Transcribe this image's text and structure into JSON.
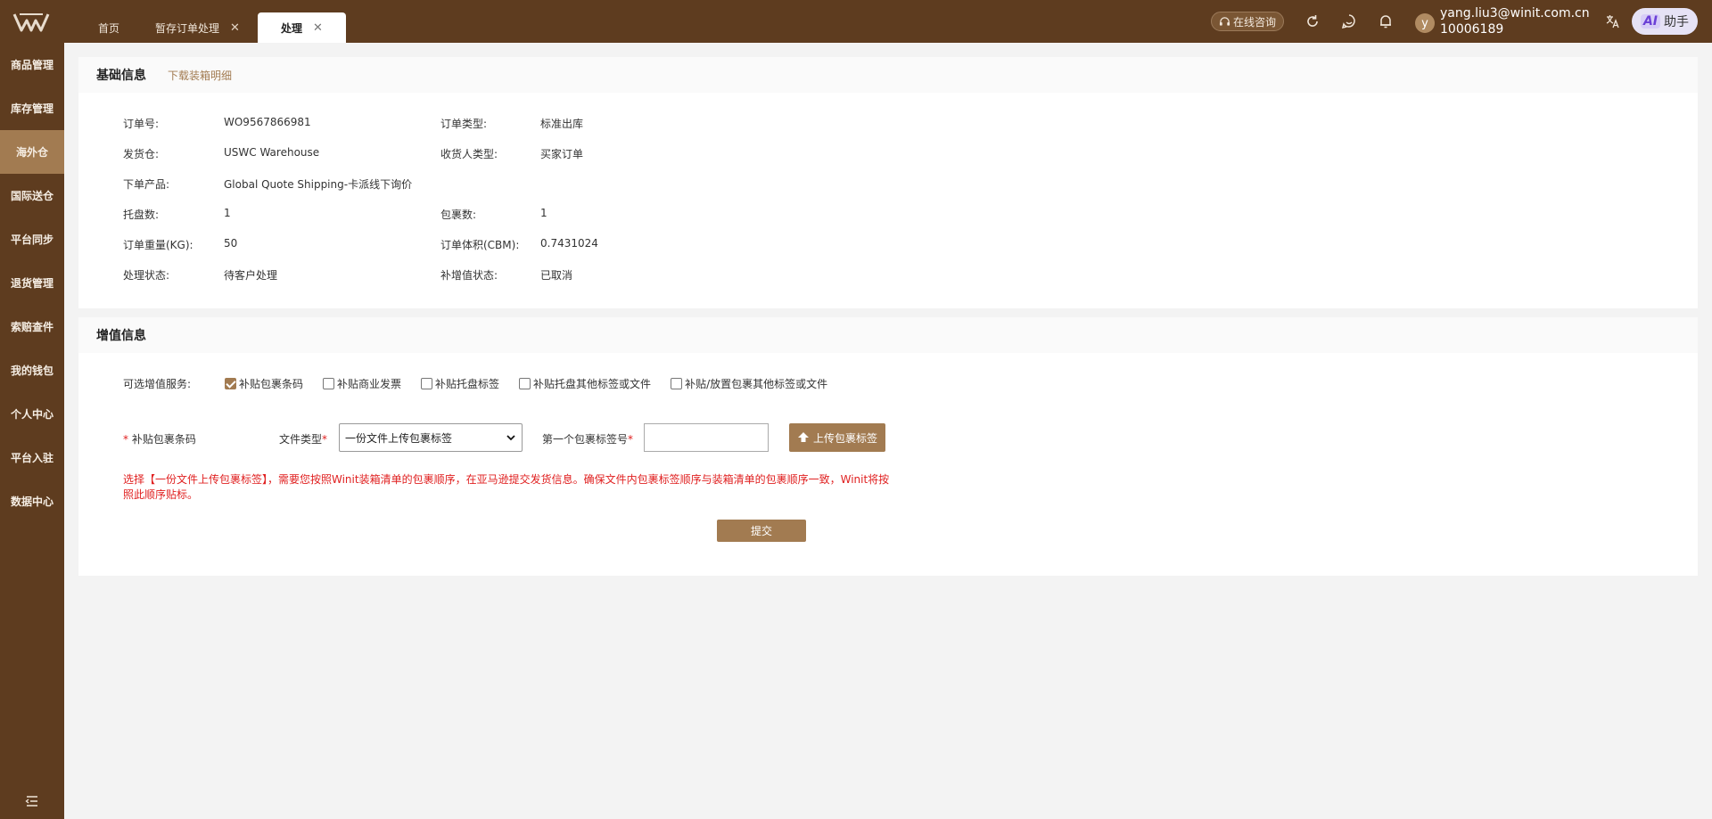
{
  "colors": {
    "brand": "#5e3c1f",
    "accent": "#a27b51",
    "warning": "#e02020"
  },
  "tabs": [
    {
      "label": "首页",
      "closable": false
    },
    {
      "label": "暂存订单处理",
      "closable": true
    },
    {
      "label": "处理",
      "closable": true,
      "active": true
    }
  ],
  "header": {
    "consult_label": "在线咨询",
    "user_email": "yang.liu3@winit.com.cn",
    "user_id": "10006189",
    "avatar_letter": "y",
    "ai_label": "AI",
    "assistant_label": "助手"
  },
  "sidebar": {
    "items": [
      {
        "label": "商品管理"
      },
      {
        "label": "库存管理"
      },
      {
        "label": "海外仓",
        "active": true
      },
      {
        "label": "国际送仓"
      },
      {
        "label": "平台同步"
      },
      {
        "label": "退货管理"
      },
      {
        "label": "索赔查件"
      },
      {
        "label": "我的钱包"
      },
      {
        "label": "个人中心"
      },
      {
        "label": "平台入驻"
      },
      {
        "label": "数据中心"
      }
    ]
  },
  "basic": {
    "title": "基础信息",
    "download_link": "下载装箱明细",
    "fields": [
      {
        "label": "订单号:",
        "value": "WO9567866981"
      },
      {
        "label": "订单类型:",
        "value": "标准出库"
      },
      {
        "label": "发货仓:",
        "value": "USWC Warehouse"
      },
      {
        "label": "收货人类型:",
        "value": "买家订单"
      },
      {
        "label": "下单产品:",
        "value": "Global Quote Shipping-卡派线下询价"
      },
      {
        "label": "托盘数:",
        "value": "1"
      },
      {
        "label": "包裹数:",
        "value": "1"
      },
      {
        "label": "订单重量(KG):",
        "value": "50"
      },
      {
        "label": "订单体积(CBM):",
        "value": "0.7431024"
      },
      {
        "label": "处理状态:",
        "value": "待客户处理"
      },
      {
        "label": "补增值状态:",
        "value": "已取消"
      }
    ]
  },
  "vas": {
    "title": "增值信息",
    "optional_label": "可选增值服务:",
    "options": [
      {
        "label": "补贴包裹条码",
        "checked": true
      },
      {
        "label": "补贴商业发票",
        "checked": false
      },
      {
        "label": "补贴托盘标签",
        "checked": false
      },
      {
        "label": "补贴托盘其他标签或文件",
        "checked": false
      },
      {
        "label": "补贴/放置包裹其他标签或文件",
        "checked": false
      }
    ],
    "barcode_label": "补贴包裹条码",
    "file_type_label": "文件类型",
    "file_type_value": "一份文件上传包裹标签",
    "first_label_label": "第一个包裹标签号",
    "first_label_value": "",
    "upload_label": "上传包裹标签",
    "tip": "选择【一份文件上传包裹标签】，需要您按照Winit装箱清单的包裹顺序，在亚马逊提交发货信息。确保文件内包裹标签顺序与装箱清单的包裹顺序一致，Winit将按照此顺序贴标。",
    "submit_label": "提交"
  }
}
